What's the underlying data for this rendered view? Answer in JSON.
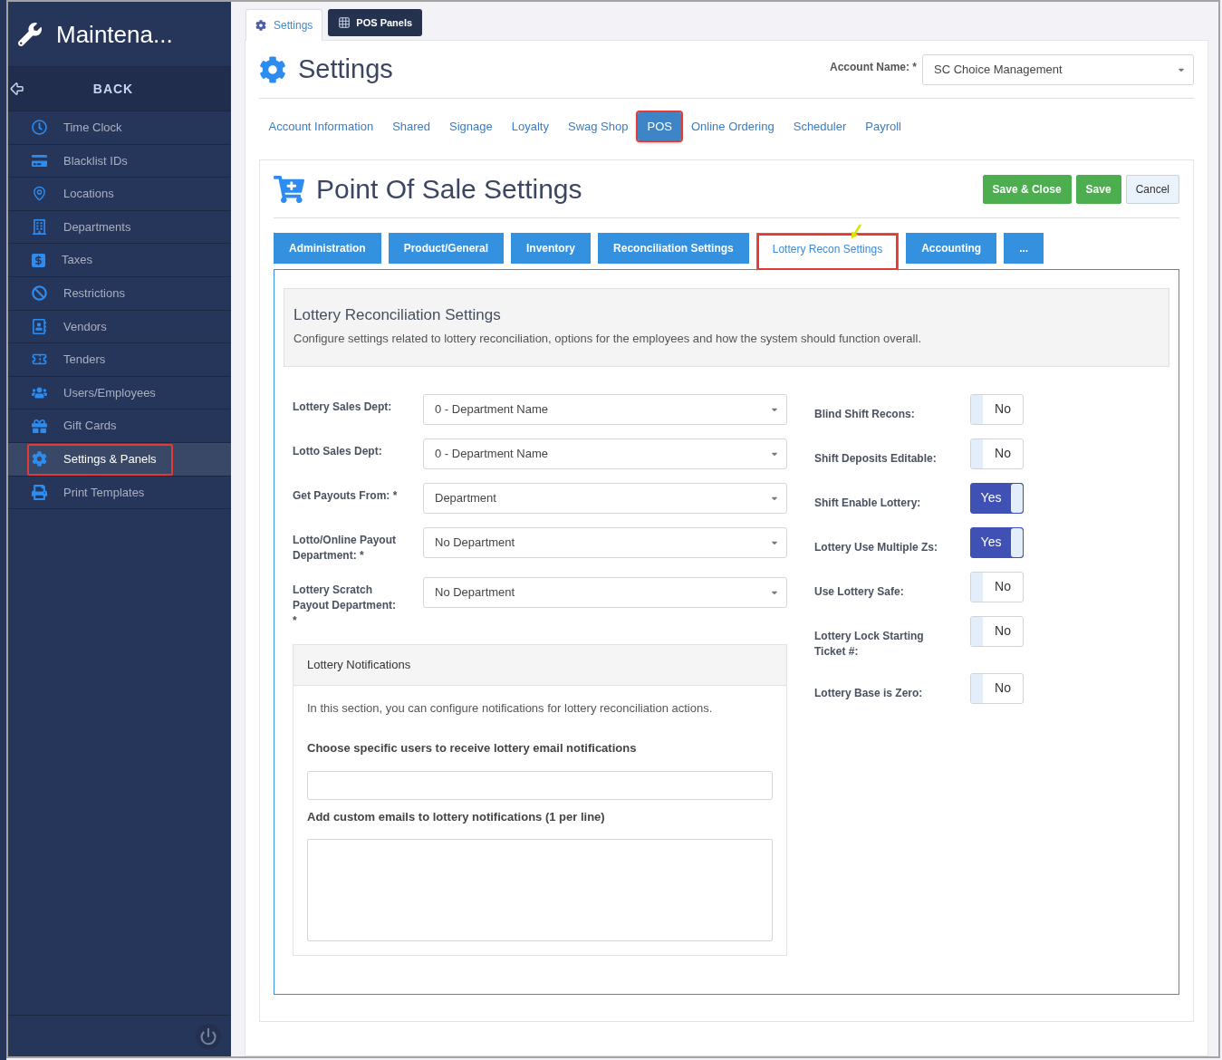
{
  "sidebar": {
    "title": "Maintena...",
    "back": "BACK",
    "items": [
      {
        "label": "Time Clock",
        "selected": false,
        "highlighted": false
      },
      {
        "label": "Blacklist IDs",
        "selected": false,
        "highlighted": false
      },
      {
        "label": "Locations",
        "selected": false,
        "highlighted": false
      },
      {
        "label": "Departments",
        "selected": false,
        "highlighted": false
      },
      {
        "label": "Taxes",
        "selected": false,
        "highlighted": false
      },
      {
        "label": "Restrictions",
        "selected": false,
        "highlighted": false
      },
      {
        "label": "Vendors",
        "selected": false,
        "highlighted": false
      },
      {
        "label": "Tenders",
        "selected": false,
        "highlighted": false
      },
      {
        "label": "Users/Employees",
        "selected": false,
        "highlighted": false
      },
      {
        "label": "Gift Cards",
        "selected": false,
        "highlighted": false
      },
      {
        "label": "Settings & Panels",
        "selected": true,
        "highlighted": true
      },
      {
        "label": "Print Templates",
        "selected": false,
        "highlighted": false
      }
    ]
  },
  "top_tabs": [
    {
      "label": "Settings",
      "selected": true
    },
    {
      "label": "POS Panels",
      "selected": false
    }
  ],
  "header": {
    "title": "Settings",
    "account_label": "Account Name: *",
    "account_value": "SC Choice Management"
  },
  "nav_links": [
    {
      "label": "Account Information",
      "selected": false,
      "highlighted": false
    },
    {
      "label": "Shared",
      "selected": false,
      "highlighted": false
    },
    {
      "label": "Signage",
      "selected": false,
      "highlighted": false
    },
    {
      "label": "Loyalty",
      "selected": false,
      "highlighted": false
    },
    {
      "label": "Swag Shop",
      "selected": false,
      "highlighted": false
    },
    {
      "label": "POS",
      "selected": true,
      "highlighted": true
    },
    {
      "label": "Online Ordering",
      "selected": false,
      "highlighted": false
    },
    {
      "label": "Scheduler",
      "selected": false,
      "highlighted": false
    },
    {
      "label": "Payroll",
      "selected": false,
      "highlighted": false
    }
  ],
  "pos": {
    "title": "Point Of Sale Settings",
    "buttons": [
      {
        "label": "Save & Close",
        "kind": "success"
      },
      {
        "label": "Save",
        "kind": "success"
      },
      {
        "label": "Cancel",
        "kind": "default"
      }
    ],
    "tabs": [
      {
        "label": "Administration",
        "selected": false,
        "highlighted": false
      },
      {
        "label": "Product/General",
        "selected": false,
        "highlighted": false
      },
      {
        "label": "Inventory",
        "selected": false,
        "highlighted": false
      },
      {
        "label": "Reconciliation Settings",
        "selected": false,
        "highlighted": false
      },
      {
        "label": "Lottery Recon Settings",
        "selected": true,
        "highlighted": true
      },
      {
        "label": "Accounting",
        "selected": false,
        "highlighted": false
      },
      {
        "label": "...",
        "selected": false,
        "highlighted": false
      }
    ],
    "section": {
      "title": "Lottery Reconciliation Settings",
      "description": "Configure settings related to lottery reconciliation, options for the employees and how the system should function overall."
    },
    "selects": [
      {
        "label": "Lottery Sales Dept:",
        "value": "0 - Department Name"
      },
      {
        "label": "Lotto Sales Dept:",
        "value": "0 - Department Name"
      },
      {
        "label": "Get Payouts From: *",
        "value": "Department"
      },
      {
        "label": "Lotto/Online Payout Department: *",
        "value": "No Department"
      },
      {
        "label": "Lottery Scratch Payout Department: *",
        "value": "No Department"
      }
    ],
    "toggles": [
      {
        "label": "Blind Shift Recons:",
        "on": false,
        "text": "No"
      },
      {
        "label": "Shift Deposits Editable:",
        "on": false,
        "text": "No"
      },
      {
        "label": "Shift Enable Lottery:",
        "on": true,
        "text": "Yes"
      },
      {
        "label": "Lottery Use Multiple Zs:",
        "on": true,
        "text": "Yes"
      },
      {
        "label": "Use Lottery Safe:",
        "on": false,
        "text": "No"
      },
      {
        "label": "Lottery Lock Starting Ticket #:",
        "on": false,
        "text": "No"
      },
      {
        "label": "Lottery Base is Zero:",
        "on": false,
        "text": "No"
      }
    ],
    "notifications": {
      "title": "Lottery Notifications",
      "intro": "In this section, you can configure notifications for lottery reconciliation actions.",
      "users_label": "Choose specific users to receive lottery email notifications",
      "emails_label": "Add custom emails to lottery notifications (1 per line)"
    }
  }
}
